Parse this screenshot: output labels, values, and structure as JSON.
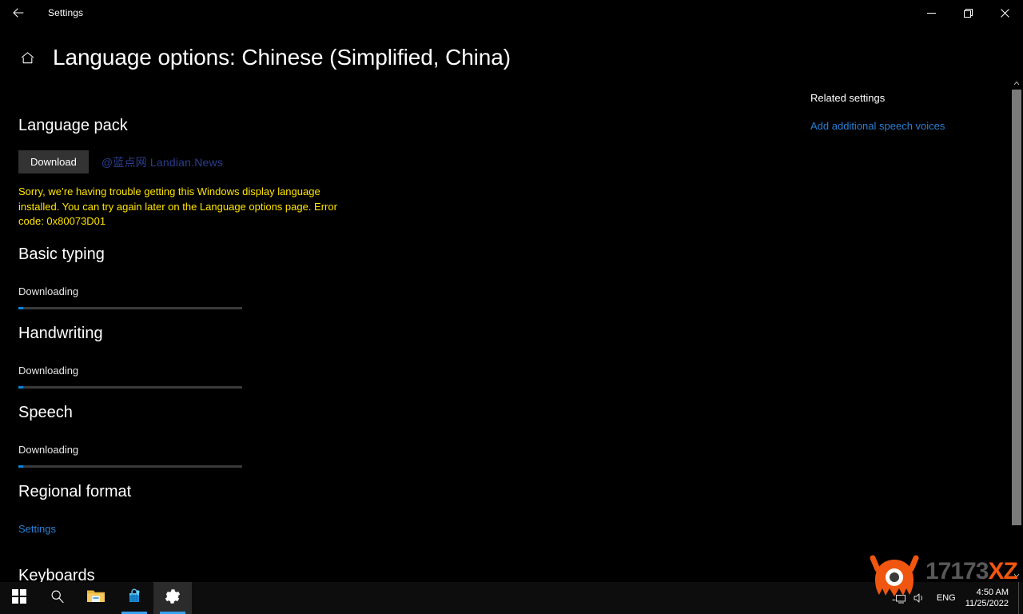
{
  "window": {
    "titlebar_label": "Settings",
    "back_icon": "back-arrow-icon",
    "minimize_label": "Minimize",
    "maximize_label": "Restore",
    "close_label": "Close"
  },
  "page": {
    "home_icon": "home-icon",
    "title": "Language options: Chinese (Simplified, China)"
  },
  "main": {
    "language_pack": {
      "heading": "Language pack",
      "download_button": "Download",
      "error_text": "Sorry, we’re having trouble getting this Windows display language installed. You can try again later on the Language options page. Error code: 0x80073D01"
    },
    "basic_typing": {
      "heading": "Basic typing",
      "status": "Downloading",
      "progress_percent": 2
    },
    "handwriting": {
      "heading": "Handwriting",
      "status": "Downloading",
      "progress_percent": 2
    },
    "speech": {
      "heading": "Speech",
      "status": "Downloading",
      "progress_percent": 2
    },
    "regional_format": {
      "heading": "Regional format",
      "settings_link": "Settings"
    },
    "keyboards": {
      "heading": "Keyboards"
    }
  },
  "related": {
    "heading": "Related settings",
    "links": [
      {
        "label": "Add additional speech voices"
      }
    ]
  },
  "watermarks": {
    "inline_site": "@蓝点网 Landian.News",
    "overlay_number": "17173",
    "overlay_suffix": "XZ"
  },
  "taskbar": {
    "items": [
      {
        "name": "start-button",
        "icon": "windows-logo-icon",
        "active": false,
        "running": false
      },
      {
        "name": "search-button",
        "icon": "search-icon",
        "active": false,
        "running": false
      },
      {
        "name": "file-explorer-button",
        "icon": "folder-icon",
        "active": false,
        "running": false
      },
      {
        "name": "microsoft-store-button",
        "icon": "store-bag-icon",
        "active": false,
        "running": true
      },
      {
        "name": "settings-button",
        "icon": "gear-icon",
        "active": true,
        "running": true
      }
    ],
    "tray": {
      "network_icon": "network-monitor-icon",
      "volume_icon": "speaker-icon",
      "language": "ENG",
      "time": "4:50 AM",
      "date": "11/25/2022"
    }
  },
  "colors": {
    "accent_blue": "#0a84d8",
    "link_blue": "#2a7fd4",
    "error_yellow": "#ffe500",
    "button_gray": "#333333",
    "track_gray": "#3a3a3a",
    "watermark_blue": "#2b3e8e",
    "overlay_orange": "#f0560f"
  }
}
